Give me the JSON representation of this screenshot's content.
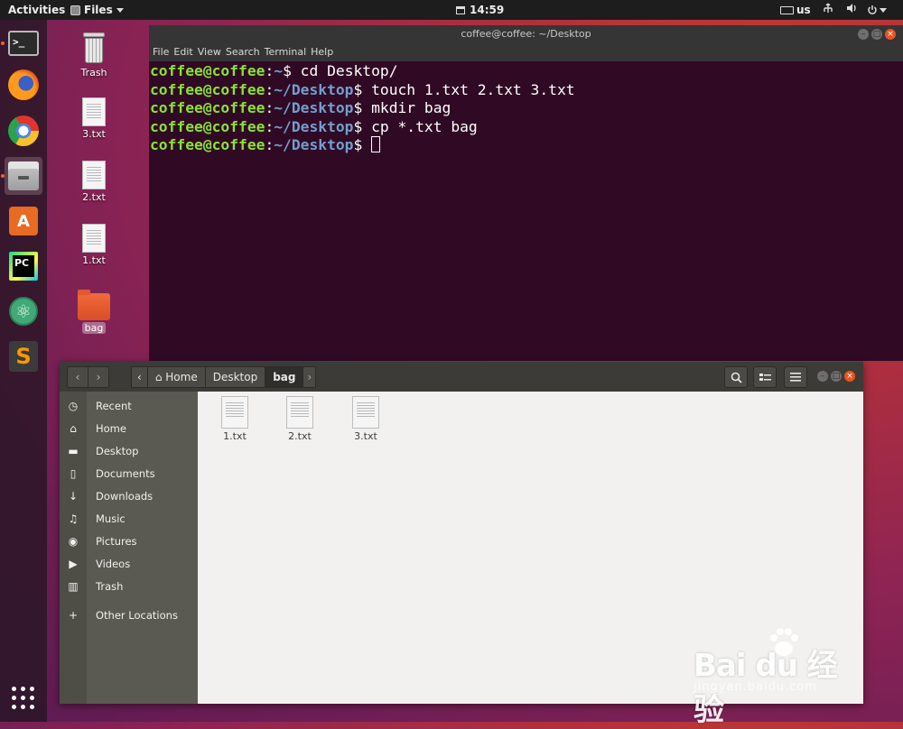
{
  "topbar": {
    "activities": "Activities",
    "app_name": "Files",
    "clock": "14:59",
    "keyboard_layout": "us",
    "icons": [
      "calendar-icon",
      "keyboard-icon",
      "network-icon",
      "volume-icon",
      "power-icon"
    ]
  },
  "dock": {
    "items": [
      "terminal",
      "firefox",
      "chrome",
      "files",
      "software-center",
      "pycharm",
      "atom",
      "sublime-text",
      "show-applications"
    ],
    "active": "files"
  },
  "desktop": {
    "icons": [
      {
        "label": "Trash"
      },
      {
        "label": "3.txt"
      },
      {
        "label": "2.txt"
      },
      {
        "label": "1.txt"
      },
      {
        "label": "bag",
        "selected": true
      }
    ]
  },
  "terminal": {
    "title": "coffee@coffee: ~/Desktop",
    "menu": [
      "File",
      "Edit",
      "View",
      "Search",
      "Terminal",
      "Help"
    ],
    "lines": [
      {
        "user": "coffee@coffee",
        "path": "~",
        "cmd": " cd Desktop/"
      },
      {
        "user": "coffee@coffee",
        "path": "~/Desktop",
        "cmd": " touch 1.txt 2.txt 3.txt"
      },
      {
        "user": "coffee@coffee",
        "path": "~/Desktop",
        "cmd": " mkdir bag"
      },
      {
        "user": "coffee@coffee",
        "path": "~/Desktop",
        "cmd": " cp *.txt bag"
      },
      {
        "user": "coffee@coffee",
        "path": "~/Desktop",
        "cmd": " "
      }
    ],
    "colors": {
      "background": "#300a24",
      "user": "#8ae234",
      "path": "#729fcf"
    }
  },
  "files": {
    "breadcrumbs": [
      "Home",
      "Desktop",
      "bag"
    ],
    "current_folder": "bag",
    "sidebar": [
      {
        "label": "Recent",
        "icon": "clock-icon",
        "glyph": "◷"
      },
      {
        "label": "Home",
        "icon": "home-icon",
        "glyph": "⌂"
      },
      {
        "label": "Desktop",
        "icon": "folder-icon",
        "glyph": "▬"
      },
      {
        "label": "Documents",
        "icon": "document-icon",
        "glyph": "▯"
      },
      {
        "label": "Downloads",
        "icon": "download-icon",
        "glyph": "↓"
      },
      {
        "label": "Music",
        "icon": "music-icon",
        "glyph": "♫"
      },
      {
        "label": "Pictures",
        "icon": "camera-icon",
        "glyph": "◉"
      },
      {
        "label": "Videos",
        "icon": "video-icon",
        "glyph": "▶"
      },
      {
        "label": "Trash",
        "icon": "trash-icon",
        "glyph": "▥"
      },
      {
        "label": "Other Locations",
        "icon": "plus-icon",
        "glyph": "+"
      }
    ],
    "items": [
      "1.txt",
      "2.txt",
      "3.txt"
    ]
  },
  "watermark": {
    "main": "Bai du 经验",
    "sub": "jingyan.baidu.com"
  },
  "colors": {
    "accent": "#e95420",
    "header": "#3c3b37",
    "sidebar": "#5b5a52"
  }
}
